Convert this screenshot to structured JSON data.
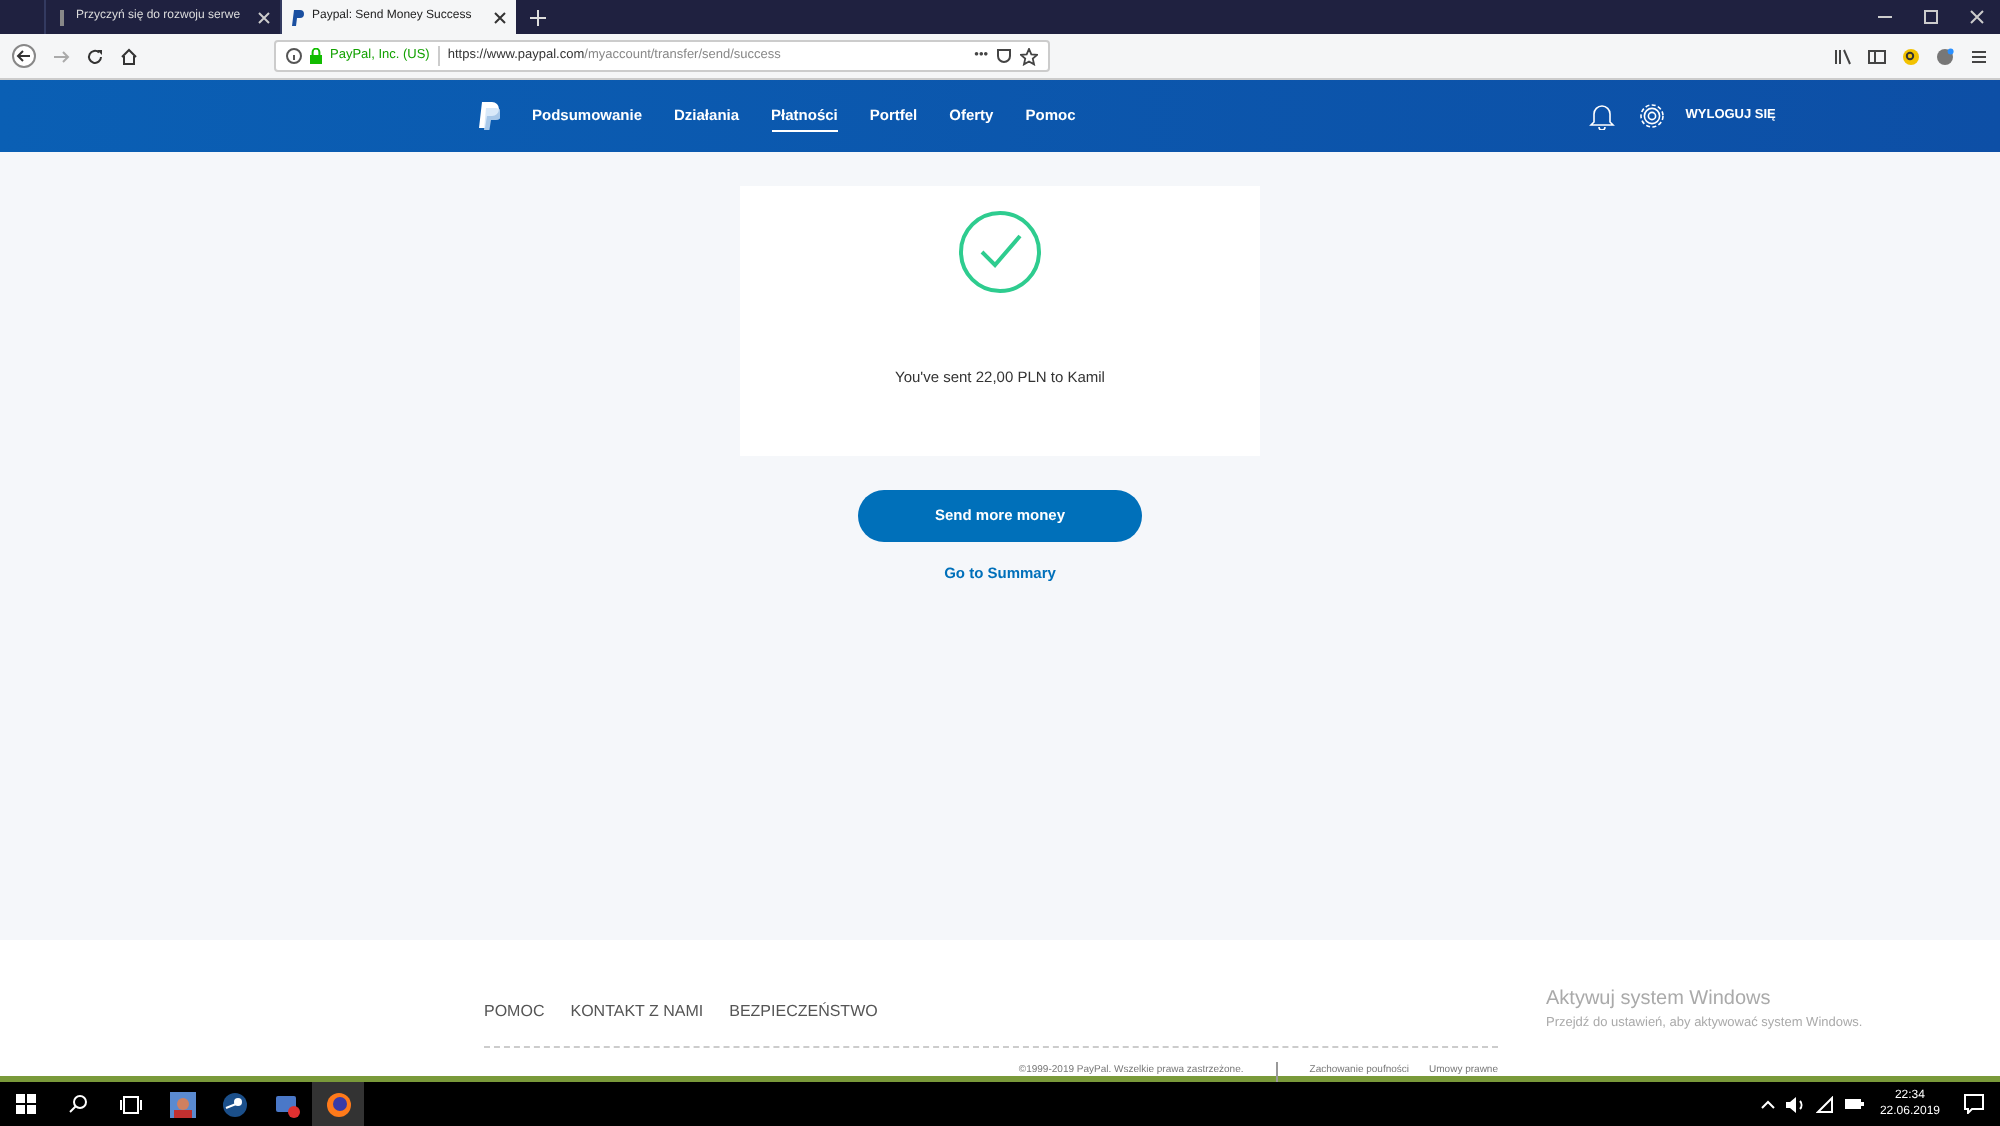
{
  "browser": {
    "tabs": [
      {
        "title": "Przyczyń się do rozwoju serwe",
        "selected": false
      },
      {
        "title": "Paypal: Send Money Success",
        "selected": true
      }
    ],
    "identity": "PayPal, Inc. (US)",
    "url_host": "https://www.paypal.com",
    "url_path": "/myaccount/transfer/send/success",
    "more": "•••"
  },
  "nav": {
    "items": [
      {
        "label": "Podsumowanie",
        "selected": false
      },
      {
        "label": "Działania",
        "selected": false
      },
      {
        "label": "Płatności",
        "selected": true
      },
      {
        "label": "Portfel",
        "selected": false
      },
      {
        "label": "Oferty",
        "selected": false
      },
      {
        "label": "Pomoc",
        "selected": false
      }
    ],
    "logout": "WYLOGUJ SIĘ"
  },
  "confirmation": {
    "message": "You've sent 22,00 PLN to Kamil"
  },
  "primary_button": "Send more money",
  "summary_link": "Go to Summary",
  "footer": {
    "links": [
      "POMOC",
      "KONTAKT Z NAMI",
      "BEZPIECZEŃSTWO"
    ],
    "copyright": "©1999-2019 PayPal. Wszelkie prawa zastrzeżone.",
    "legal_links": [
      "Zachowanie poufności",
      "Umowy prawne"
    ]
  },
  "activation": {
    "title": "Aktywuj system Windows",
    "subtitle": "Przejdź do ustawień, aby aktywować system Windows."
  },
  "taskbar": {
    "time": "22:34",
    "date": "22.06.2019"
  }
}
